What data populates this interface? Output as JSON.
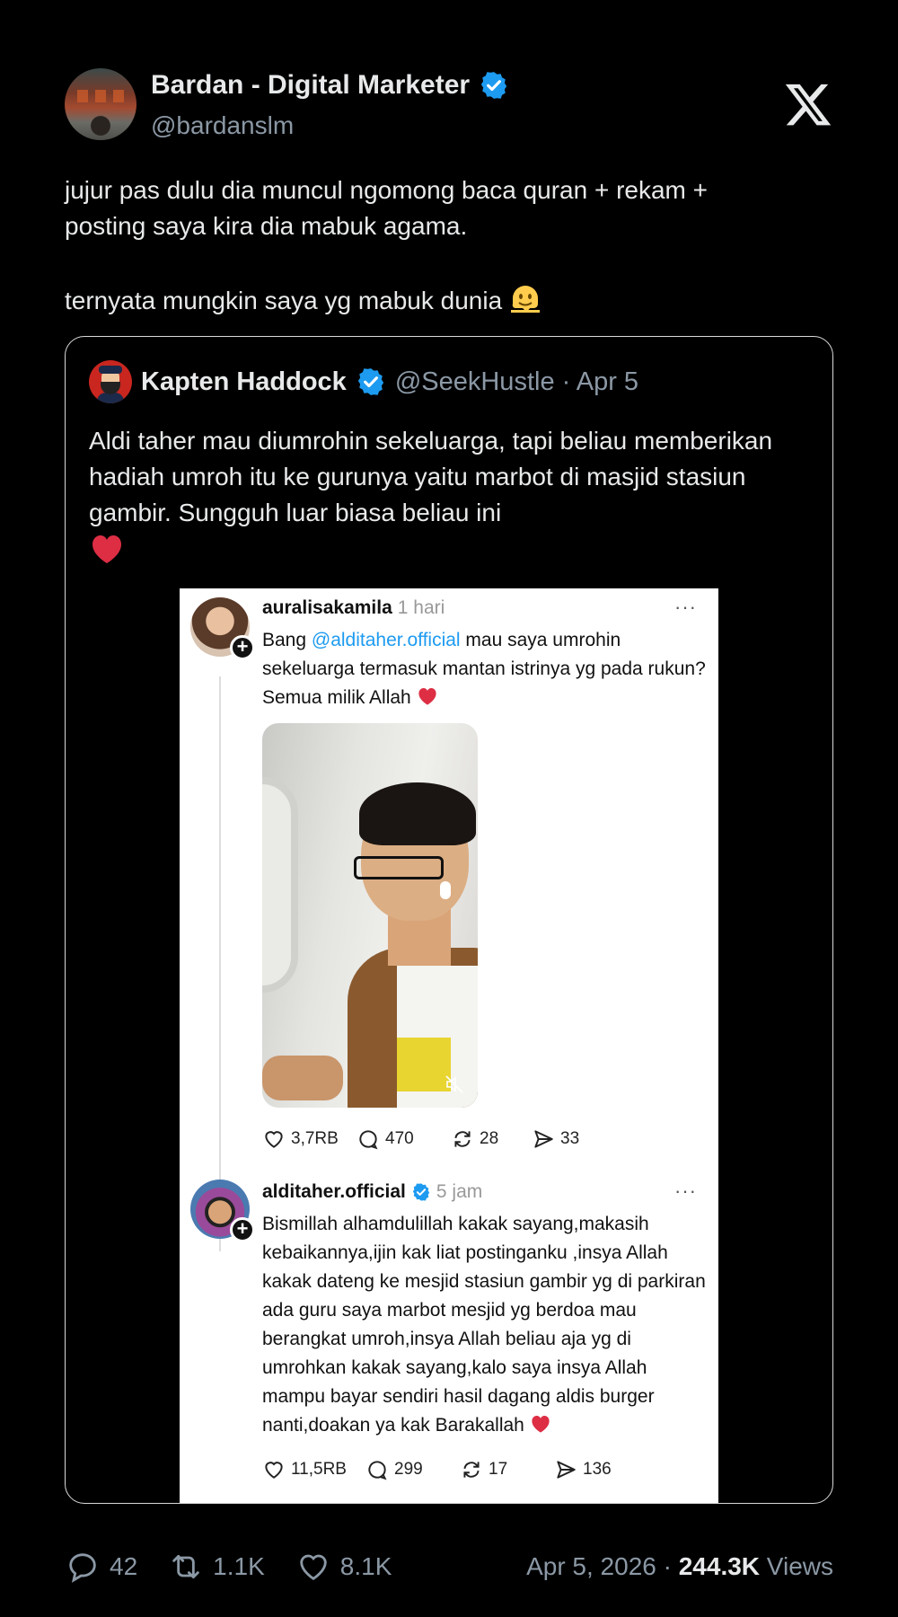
{
  "author": {
    "name": "Bardan - Digital Marketer",
    "handle": "@bardanslm"
  },
  "tweet": {
    "line1": "jujur pas dulu dia muncul ngomong baca quran + rekam +",
    "line2": "posting saya kira dia mabuk agama.",
    "line3": "ternyata mungkin saya yg mabuk dunia"
  },
  "quote": {
    "name": "Kapten Haddock",
    "handle_date": "@SeekHustle · Apr 5",
    "text": "Aldi taher mau diumrohin sekeluarga, tapi beliau memberikan hadiah umroh itu ke gurunya yaitu marbot di masjid stasiun gambir. Sungguh luar biasa beliau ini"
  },
  "screenshot": {
    "post1": {
      "user": "auralisakamila",
      "time": "1 hari",
      "text_before": "Bang ",
      "mention": "@alditaher.official",
      "text_after": " mau saya umrohin sekeluarga termasuk mantan istrinya yg pada rukun? Semua milik Allah",
      "likes": "3,7RB",
      "comments": "470",
      "reposts": "28",
      "shares": "33"
    },
    "post2": {
      "user": "alditaher.official",
      "time": "5 jam",
      "text": "Bismillah alhamdulillah kakak sayang,makasih kebaikannya,ijin kak liat postinganku ,insya Allah kakak dateng ke mesjid stasiun gambir yg di parkiran ada guru saya marbot mesjid yg berdoa mau berangkat umroh,insya Allah beliau aja yg di umrohkan kakak sayang,kalo saya insya Allah mampu bayar sendiri hasil dagang aldis burger nanti,doakan ya kak Barakallah",
      "likes": "11,5RB",
      "comments": "299",
      "reposts": "17",
      "shares": "136"
    },
    "menu_label": "···"
  },
  "stats": {
    "replies": "42",
    "reposts": "1.1K",
    "likes": "8.1K",
    "date": "Apr 5, 2026 · ",
    "views_count": "244.3K",
    "views_label": " Views"
  },
  "colors": {
    "background": "#000000",
    "verified": "#1d9bf0",
    "muted": "#8b98a5",
    "heart": "#e0245e"
  }
}
